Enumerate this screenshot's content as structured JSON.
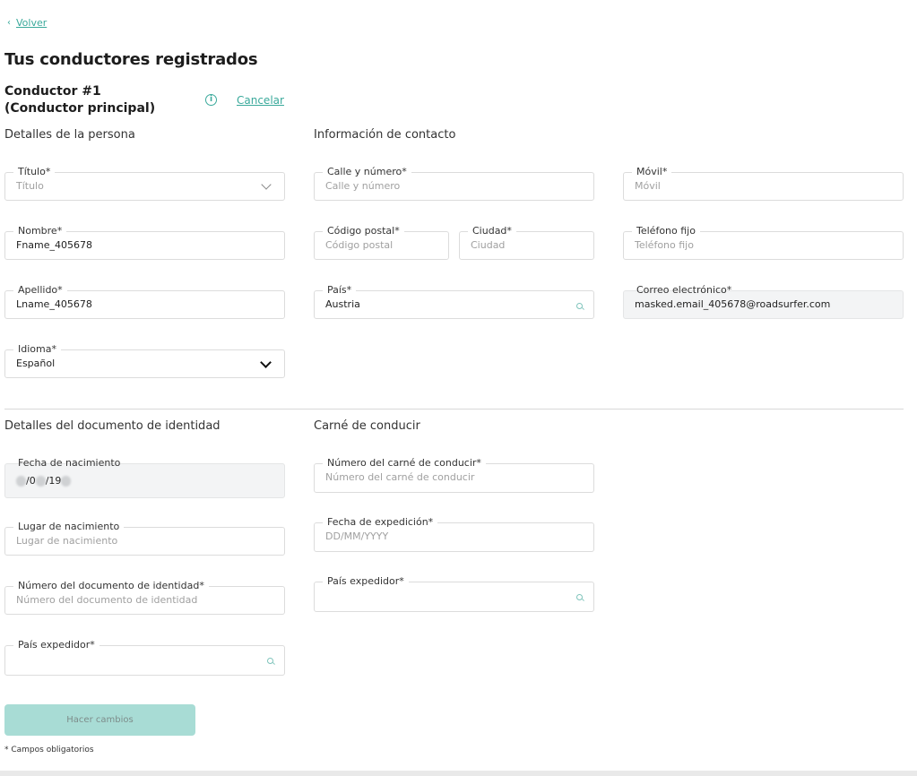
{
  "nav": {
    "back_label": "Volver"
  },
  "page_title": "Tus conductores registrados",
  "driver": {
    "heading": "Conductor #1  (Conductor principal)",
    "cancel_label": "Cancelar",
    "info_icon": "info-icon"
  },
  "sections": {
    "personal": "Detalles de la persona",
    "contact": "Información de contacto",
    "identity": "Detalles del documento de identidad",
    "license": "Carné de conducir"
  },
  "fields": {
    "titulo": {
      "label": "Título*",
      "placeholder": "Título"
    },
    "nombre": {
      "label": "Nombre*",
      "value": "Fname_405678"
    },
    "apellido": {
      "label": "Apellido*",
      "value": "Lname_405678"
    },
    "idioma": {
      "label": "Idioma*",
      "value": "Español"
    },
    "calle": {
      "label": "Calle y número*",
      "placeholder": "Calle y número"
    },
    "cp": {
      "label": "Código postal*",
      "placeholder": "Código postal"
    },
    "ciudad": {
      "label": "Ciudad*",
      "placeholder": "Ciudad"
    },
    "pais": {
      "label": "País*",
      "value": "Austria"
    },
    "movil": {
      "label": "Móvil*",
      "placeholder": "Móvil"
    },
    "fijo": {
      "label": "Teléfono fijo",
      "placeholder": "Teléfono fijo"
    },
    "correo": {
      "label": "Correo electrónico*",
      "value": "masked.email_405678@roadsurfer.com"
    },
    "nacimiento": {
      "label": "Fecha de nacimiento",
      "value_parts": [
        "/0",
        "/19"
      ]
    },
    "lugar": {
      "label": "Lugar de nacimiento",
      "placeholder": "Lugar de nacimiento"
    },
    "doc_num": {
      "label": "Número del documento de identidad*",
      "placeholder": "Número del documento de identidad"
    },
    "doc_pais": {
      "label": "País expedidor*"
    },
    "lic_num": {
      "label": "Número del carné de conducir*",
      "placeholder": "Número del carné de conducir"
    },
    "lic_fecha": {
      "label": "Fecha de expedición*",
      "placeholder": "DD/MM/YYYY"
    },
    "lic_pais": {
      "label": "País expedidor*"
    }
  },
  "submit_label": "Hacer cambios",
  "footnote": "* Campos obligatorios",
  "colors": {
    "accent": "#3aa99b",
    "button": "#a8dcd5"
  }
}
